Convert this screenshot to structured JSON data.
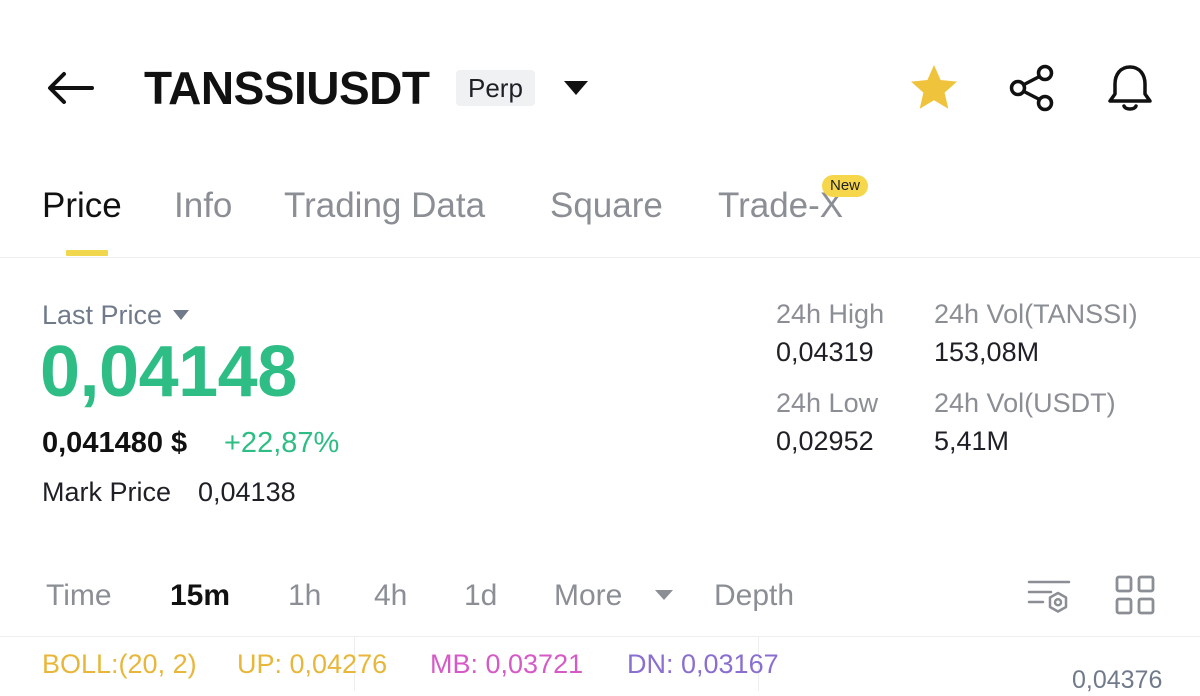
{
  "header": {
    "symbol": "TANSSIUSDT",
    "contract_type": "Perp",
    "icons": [
      "back-arrow-icon",
      "chevron-down-icon",
      "star-icon",
      "share-icon",
      "bell-icon"
    ]
  },
  "tabs": [
    {
      "label": "Price",
      "active": true
    },
    {
      "label": "Info"
    },
    {
      "label": "Trading Data"
    },
    {
      "label": "Square"
    },
    {
      "label": "Trade-X",
      "badge": "New"
    }
  ],
  "price": {
    "last_price_label": "Last Price",
    "last_price": "0,04148",
    "usd_price": "0,041480 $",
    "change_pct": "+22,87%",
    "mark_price_label": "Mark Price",
    "mark_price": "0,04138"
  },
  "stats": {
    "high_label": "24h High",
    "high_value": "0,04319",
    "low_label": "24h Low",
    "low_value": "0,02952",
    "vol_base_label": "24h Vol(TANSSI)",
    "vol_base_value": "153,08M",
    "vol_quote_label": "24h Vol(USDT)",
    "vol_quote_value": "5,41M"
  },
  "intervals": [
    {
      "label": "Time"
    },
    {
      "label": "15m",
      "active": true
    },
    {
      "label": "1h"
    },
    {
      "label": "4h"
    },
    {
      "label": "1d"
    },
    {
      "label": "More"
    },
    {
      "label": "Depth"
    }
  ],
  "indicator": {
    "boll": "BOLL:(20, 2)",
    "up": "UP: 0,04276",
    "mb": "MB: 0,03721",
    "dn": "DN: 0,03167"
  },
  "axis_top_value": "0,04376",
  "colors": {
    "accent": "#f0b90b",
    "up_green": "#2ebd85",
    "boll_up": "#e8b73a",
    "boll_mb": "#d65ac6",
    "boll_dn": "#8a6fd1"
  }
}
